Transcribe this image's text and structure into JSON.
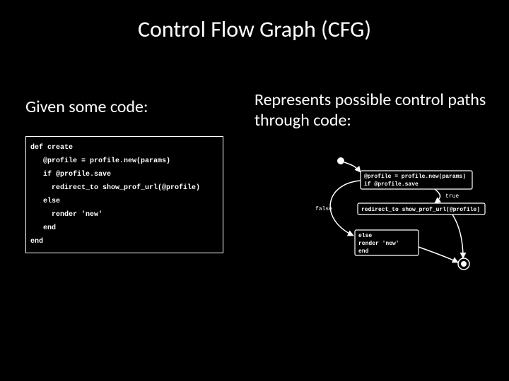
{
  "title": "Control Flow Graph (CFG)",
  "left": {
    "subhead": "Given some code:",
    "code": "def create\n   @profile = profile.new(params)\n   if @profile.save\n     redirect_to show_prof_url(@profile)\n   else\n     render 'new'\n   end\nend"
  },
  "right": {
    "subhead": "Represents possible control paths through code:"
  },
  "cfg": {
    "node1_line1": "@profile = profile.new(params)",
    "node1_line2": "if @profile.save",
    "node2_line1": "redirect_to show_prof_url(@profile)",
    "node3_line1": "else",
    "node3_line2": "  render 'new'",
    "node3_line3": "end",
    "edge_true": "true",
    "edge_false": "false"
  }
}
